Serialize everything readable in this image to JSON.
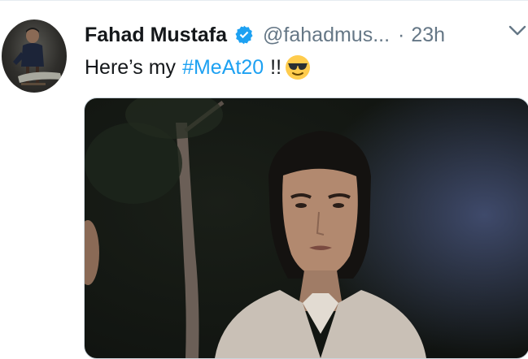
{
  "tweet": {
    "author_name": "Fahad Mustafa",
    "handle": "@fahadmus...",
    "separator": "·",
    "timestamp": "23h",
    "text_prefix": "Here’s my",
    "hashtag": "#MeAt20",
    "text_suffix": "!!",
    "emoji": "smiling-face-with-sunglasses",
    "verified": true
  },
  "icons": {
    "verified": "verified-badge-icon",
    "caret": "chevron-down-icon"
  },
  "colors": {
    "link": "#1da1f2",
    "secondary_text": "#657786",
    "primary_text": "#14171a",
    "verified_badge": "#1da1f2"
  }
}
